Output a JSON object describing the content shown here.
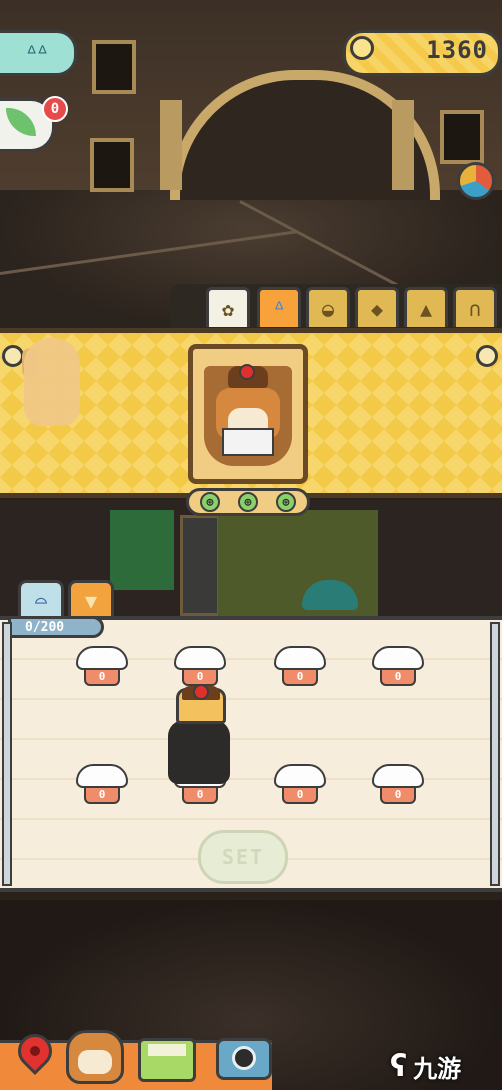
{
  "hud": {
    "coins": "1360",
    "notification_count": "0"
  },
  "category_tabs": [
    {
      "name": "flower",
      "icon": "✿",
      "active": true
    },
    {
      "name": "bunny",
      "icon": "ᐞ"
    },
    {
      "name": "basket",
      "icon": "◒"
    },
    {
      "name": "stone",
      "icon": "◆"
    },
    {
      "name": "rock",
      "icon": "▲"
    },
    {
      "name": "arch",
      "icon": "∩"
    }
  ],
  "showcase": {
    "arrows": [
      "⊕",
      "⊕",
      "⊕"
    ]
  },
  "outfit_panel": {
    "counter": "0/200",
    "slot_values": [
      "0",
      "0",
      "0",
      "0",
      "0",
      "0",
      "0",
      "0"
    ],
    "set_label": "SET"
  },
  "watermark": {
    "text": "九游",
    "mark": "ʕ"
  },
  "colors": {
    "accent_yellow": "#f3c948",
    "panel_cream": "#f6eddc",
    "toolbar_orange": "#f08a3a",
    "badge_red": "#e74a4a"
  }
}
